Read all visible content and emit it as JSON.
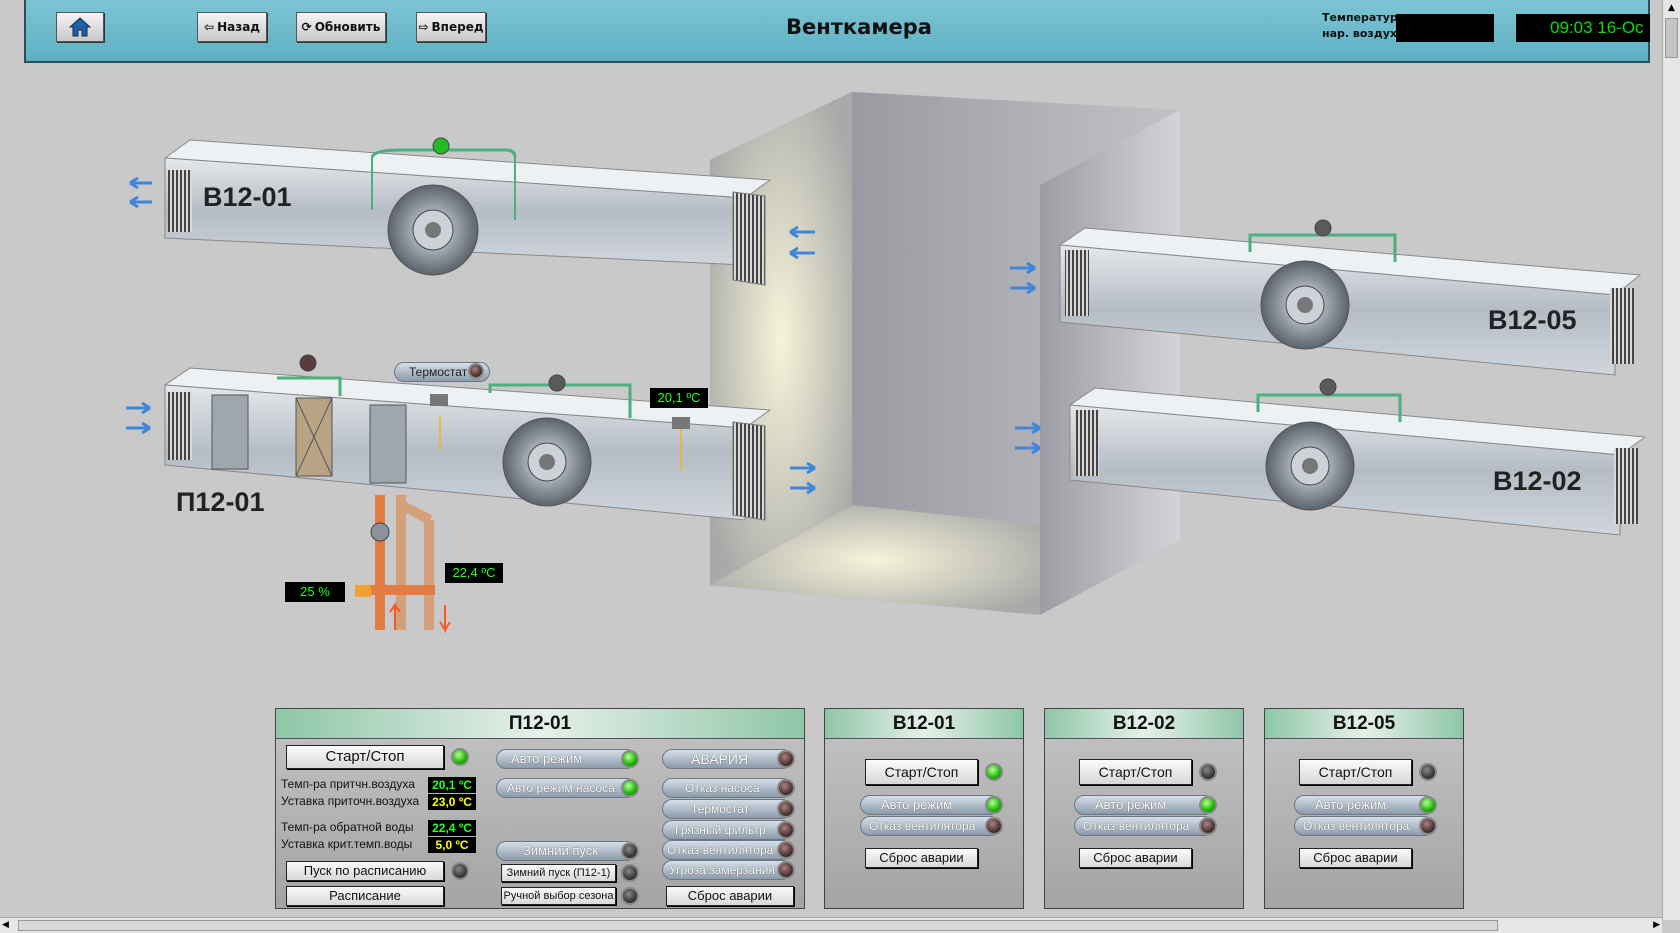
{
  "header": {
    "home_label": "",
    "back_label": "Назад",
    "refresh_label": "Обновить",
    "forward_label": "Вперед",
    "title": "Венткамера",
    "outdoor_temp_label_1": "Температура",
    "outdoor_temp_label_2": "нар. воздуха",
    "clock": "09:03 16-Oc"
  },
  "scene": {
    "units": {
      "b12_01": "В12-01",
      "p12_01": "П12-01",
      "b12_05": "В12-05",
      "b12_02": "В12-02"
    },
    "thermostat_label": "Термостат",
    "supply_temp": "20,1 ºC",
    "water_temp": "22,4 ºC",
    "valve_percent": "25 %"
  },
  "p12_panel": {
    "title": "П12-01",
    "start_stop": "Старт/Стоп",
    "auto_mode": "Авто режим",
    "alarm": "АВАРИЯ",
    "supply_air_temp_label": "Темп-ра притчн.воздуха",
    "supply_air_temp": "20,1 ºC",
    "supply_setpoint_label": "Уставка приточн.воздуха",
    "supply_setpoint": "23,0 ºC",
    "pump_auto_mode": "Авто режим насоса",
    "pump_fault": "Отказ насоса",
    "thermostat": "Термостат",
    "dirty_filter": "Грязный фильтр",
    "return_water_temp_label": "Темп-ра обратной воды",
    "return_water_temp": "22,4 ºC",
    "crit_setpoint_label": "Уставка крит.темп.воды",
    "crit_setpoint": "5,0 ºC",
    "winter_start": "Зимний пуск",
    "winter_start_p12": "Зимний пуск (П12-1)",
    "manual_season": "Ручной выбор сезона",
    "fan_fault": "Отказ вентилятора",
    "freeze_threat": "Угроза замерзания",
    "scheduled_start": "Пуск по расписанию",
    "schedule": "Расписание",
    "reset_alarm": "Сброс аварии"
  },
  "fan_panels": [
    {
      "title": "В12-01",
      "start_stop": "Старт/Стоп",
      "auto_mode": "Авто режим",
      "fan_fault": "Отказ вентилятора",
      "reset": "Сброс аварии"
    },
    {
      "title": "В12-02",
      "start_stop": "Старт/Стоп",
      "auto_mode": "Авто режим",
      "fan_fault": "Отказ вентилятора",
      "reset": "Сброс аварии"
    },
    {
      "title": "В12-05",
      "start_stop": "Старт/Стоп",
      "auto_mode": "Авто режим",
      "fan_fault": "Отказ вентилятора",
      "reset": "Сброс аварии"
    }
  ],
  "colors": {
    "header_bg": "#6bbacb",
    "ok_led": "#19b800",
    "value_green": "#22ff22",
    "value_yellow": "#ffff00",
    "arrow_blue": "#3f86d8"
  }
}
